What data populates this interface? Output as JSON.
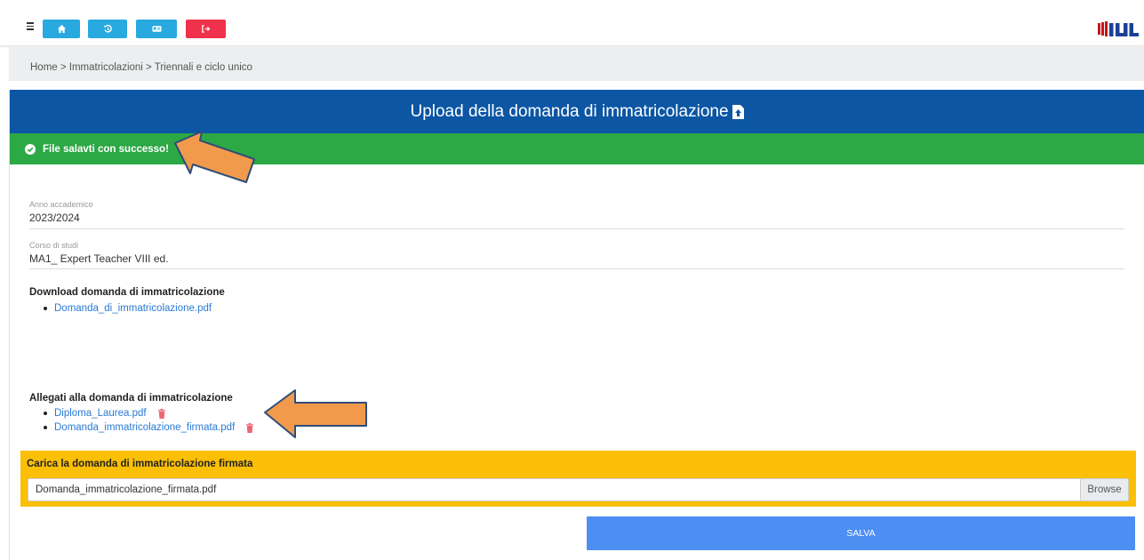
{
  "breadcrumb": "Home > Immatricolazioni > Triennali e ciclo unico",
  "page_title": "Upload della domanda di immatricolazione",
  "alert": {
    "text": "File salavti con successo!",
    "color": "#2ca844"
  },
  "fields": [
    {
      "label": "Anno accademico",
      "value": "2023/2024"
    },
    {
      "label": "Corso di studi",
      "value": "MA1_ Expert Teacher VIII ed."
    }
  ],
  "download": {
    "title": "Download domanda di immatricolazione",
    "files": [
      "Domanda_di_immatricolazione.pdf"
    ]
  },
  "attachments": {
    "title": "Allegati alla domanda di immatricolazione",
    "files": [
      "Diploma_Laurea.pdf",
      "Domanda_immatricolazione_firmata.pdf"
    ]
  },
  "upload": {
    "title": "Carica la domanda di immatricolazione firmata",
    "filename": "Domanda_immatricolazione_firmata.pdf",
    "browse_label": "Browse"
  },
  "save_label": "SALVA",
  "toolbar": {
    "buttons": [
      {
        "icon": "home-icon",
        "color": "#28a9e0"
      },
      {
        "icon": "history-icon",
        "color": "#28a9e0"
      },
      {
        "icon": "id-card-icon",
        "color": "#28a9e0"
      },
      {
        "icon": "logout-icon",
        "color": "#f0314b"
      }
    ]
  },
  "colors": {
    "header": "#0c56a4",
    "upload_box": "#fbbf05",
    "save_button": "#4d8ef3",
    "link": "#2a7ad3"
  }
}
